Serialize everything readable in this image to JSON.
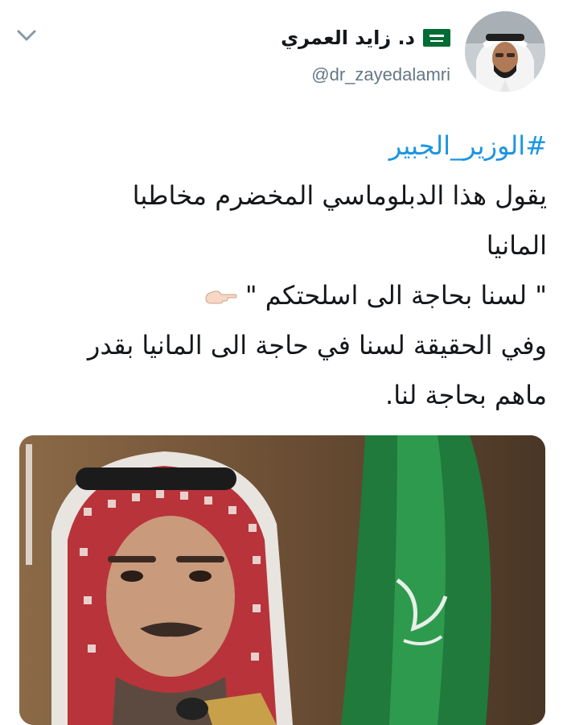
{
  "user": {
    "display_name": "د. زايد العمري",
    "handle": "@dr_zayedalamri"
  },
  "tweet": {
    "hashtag": "#الوزير_الجبير",
    "line1": "يقول هذا الدبلوماسي المخضرم مخاطبا",
    "line2": "المانيا",
    "quote": "\" لسنا بحاجة الى اسلحتكم \"",
    "line4": "وفي الحقيقة لسنا في حاجة الى المانيا بقدر",
    "line5": "ماهم بحاجة لنا."
  },
  "icons": {
    "menu": "chevron-down-icon",
    "flag": "saudi-flag-icon",
    "pointer": "pointing-hand-icon"
  },
  "colors": {
    "link": "#1b95e0",
    "text": "#14171a",
    "secondary": "#657786",
    "flag_green": "#006c35"
  }
}
